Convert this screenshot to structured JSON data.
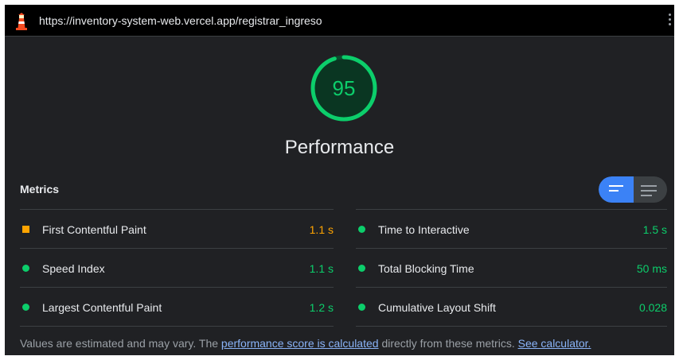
{
  "address_bar": {
    "url": "https://inventory-system-web.vercel.app/registrar_ingreso",
    "icon": "lighthouse-icon",
    "menu_icon": "kebab-menu-icon"
  },
  "category": {
    "score": "95",
    "score_fraction": 0.95,
    "title": "Performance",
    "color": "#0cce6b"
  },
  "metrics": {
    "heading": "Metrics",
    "view_toggle": {
      "active": "compact",
      "compact_icon": "compact-view-icon",
      "expanded_icon": "expanded-view-icon",
      "active_color": "#3b82f6"
    },
    "left": [
      {
        "name": "First Contentful Paint",
        "value": "1.1 s",
        "status": "average",
        "color": "#ffa400"
      },
      {
        "name": "Speed Index",
        "value": "1.1 s",
        "status": "pass",
        "color": "#0cce6b"
      },
      {
        "name": "Largest Contentful Paint",
        "value": "1.2 s",
        "status": "pass",
        "color": "#0cce6b"
      }
    ],
    "right": [
      {
        "name": "Time to Interactive",
        "value": "1.5 s",
        "status": "pass",
        "color": "#0cce6b"
      },
      {
        "name": "Total Blocking Time",
        "value": "50 ms",
        "status": "pass",
        "color": "#0cce6b"
      },
      {
        "name": "Cumulative Layout Shift",
        "value": "0.028",
        "status": "pass",
        "color": "#0cce6b"
      }
    ]
  },
  "footer": {
    "text_before": "Values are estimated and may vary. The ",
    "link1": "performance score is calculated",
    "text_middle": " directly from these metrics. ",
    "link2": "See calculator."
  }
}
